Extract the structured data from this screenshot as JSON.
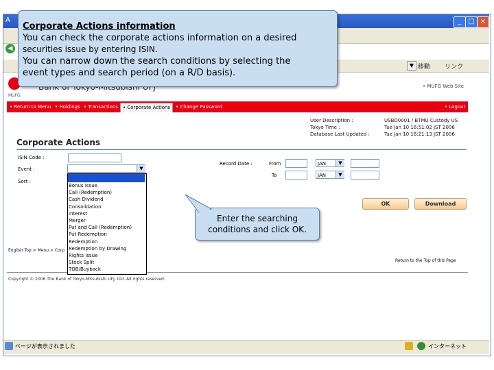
{
  "callout": {
    "title": "Corporate Actions information",
    "line1": "You can check the corporate actions information on a desired",
    "line2": "securities issue by entering ISIN.",
    "line3": "You can narrow down the search conditions by selecting the",
    "line4": "event types and search period (on a R/D basis)."
  },
  "bubble": {
    "line1": "Enter the searching",
    "line2": "conditions and click OK."
  },
  "browser": {
    "title_prefix": "A",
    "links_label": "リンク",
    "go_label": "移動",
    "status_left": "ページが表示されました",
    "status_right": "インターネット"
  },
  "header": {
    "logo_text": "Bank of Tokyo-Mitsubishi UFJ",
    "logo_small": "MUFG",
    "website_link": "• MUFG Web Site"
  },
  "nav": {
    "return_menu": "• Return to Menu",
    "holdings": "• Holdings",
    "transactions": "• Transactions",
    "corporate_actions": "• Corporate Actions",
    "change_password": "• Change Password",
    "logout": "• Logout"
  },
  "userinfo": {
    "desc_label": "User Description :",
    "desc_value": "USBD0001 / BTMU Custody US",
    "tokyo_label": "Tokyo Time :",
    "tokyo_value": "Tue Jan 10 16:51:02 JST 2006",
    "db_label": "Database Last Updated :",
    "db_value": "Tue Jan 10 16:21:13 JST 2006"
  },
  "form": {
    "title": "Corporate Actions",
    "isin_label": "ISIN Code :",
    "event_label": "Event :",
    "sort_label": "Sort :",
    "record_date_label": "Record Date :",
    "from_label": "From",
    "to_label": "To",
    "month_from": "JAN",
    "month_to": "JAN",
    "ok_label": "OK",
    "download_label": "Download"
  },
  "event_options": [
    "Bonus Issue",
    "Call (Redemption)",
    "Cash Dividend",
    "Consolidation",
    "Interest",
    "Merger",
    "Put and Call (Redemption)",
    "Put Redemption",
    "Redemption",
    "Redemption by Drawing",
    "Rights Issue",
    "Stock Split",
    "TOB/Buyback"
  ],
  "footer": {
    "left_links": "English Top > Menu > Corp",
    "return_top": "Return to the Top of this Page",
    "copyright": "Copyright © 2006 The Bank of Tokyo-Mitsubishi UFJ, Ltd. All rights reserved."
  }
}
